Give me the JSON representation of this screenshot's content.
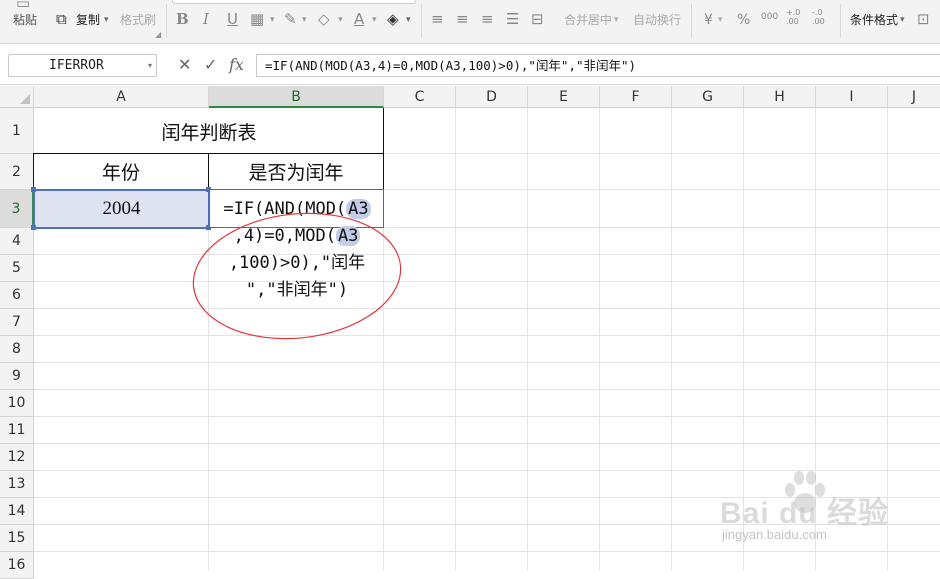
{
  "ribbon": {
    "paste": "粘贴",
    "copy": "复制",
    "format_painter": "格式刷",
    "bold": "B",
    "italic": "I",
    "underline": "U",
    "font_color": "A",
    "merge_center": "合并居中",
    "wrap_text": "自动换行",
    "currency": "¥",
    "percent": "%",
    "thousands": "000",
    "inc_decimal": "+.0 .00",
    "dec_decimal": "-.0 .00",
    "conditional_format": "条件格式",
    "dropdown_glyph": "▾"
  },
  "formula_bar": {
    "name_box": "IFERROR",
    "cancel_glyph": "✕",
    "confirm_glyph": "✓",
    "fx": "fx",
    "formula": "=IF(AND(MOD(A3,4)=0,MOD(A3,100)>0),\"闰年\",\"非闰年\")"
  },
  "columns": [
    "A",
    "B",
    "C",
    "D",
    "E",
    "F",
    "G",
    "H",
    "I",
    "J"
  ],
  "rows": [
    "1",
    "2",
    "3",
    "4",
    "5",
    "6",
    "7",
    "8",
    "9",
    "10",
    "11",
    "12",
    "13",
    "14",
    "15",
    "16"
  ],
  "cells": {
    "title": "闰年判断表",
    "header_year": "年份",
    "header_is_leap": "是否为闰年",
    "a3_value": "2004"
  },
  "edit": {
    "line1_prefix": "=IF(AND(MOD(",
    "line1_ref": "A3",
    "line2_prefix": ",4)=0,MOD(",
    "line2_ref": "A3",
    "line3": ",100)>0),\"闰年",
    "line4": "\",\"非闰年\")"
  },
  "watermark": {
    "brand": "Bai du 经验",
    "url": "jingyan.baidu.com"
  },
  "colors": {
    "selected_header": "#2e8b44",
    "selection_fill": "#dfe3f1",
    "reference_highlight": "#c3cde8",
    "annotation_circle": "#e0383b"
  },
  "icons": [
    "paste-icon",
    "copy-icon",
    "format-painter-icon",
    "border-icon",
    "fill-color-icon",
    "font-color-icon",
    "eraser-icon",
    "align-left-icon",
    "align-center-icon",
    "align-right-icon",
    "justify-icon",
    "distributed-icon",
    "merge-center-icon",
    "wrap-text-icon",
    "currency-icon",
    "percent-icon",
    "thousands-icon",
    "conditional-format-icon",
    "cancel-icon",
    "confirm-icon",
    "fx-icon",
    "select-all-icon"
  ]
}
